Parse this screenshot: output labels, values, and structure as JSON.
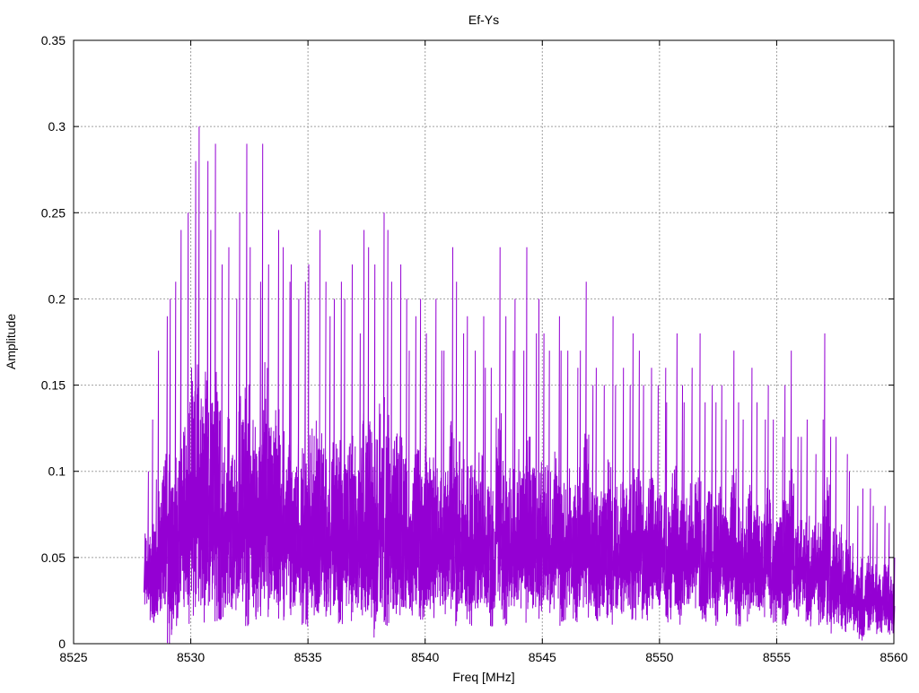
{
  "chart_data": {
    "type": "line",
    "title": "Ef-Ys",
    "xlabel": "Freq [MHz]",
    "ylabel": "Amplitude",
    "xlim": [
      8525,
      8560
    ],
    "ylim": [
      0,
      0.35
    ],
    "xticks": [
      8525,
      8530,
      8535,
      8540,
      8545,
      8550,
      8555,
      8560
    ],
    "yticks": [
      0,
      0.05,
      0.1,
      0.15,
      0.2,
      0.25,
      0.3,
      0.35
    ],
    "ytick_labels": [
      "0",
      "0.05",
      "0.1",
      "0.15",
      "0.2",
      "0.25",
      "0.3",
      "0.35"
    ],
    "grid": true,
    "legend": "none",
    "series": [
      {
        "name": "Ef-Ys",
        "color": "#9400d3",
        "x_start": 8528,
        "x_step": 0.25,
        "bin_max": [
          0.1,
          0.13,
          0.17,
          0.19,
          0.2,
          0.21,
          0.24,
          0.25,
          0.28,
          0.3,
          0.28,
          0.24,
          0.29,
          0.22,
          0.23,
          0.2,
          0.25,
          0.29,
          0.23,
          0.21,
          0.29,
          0.22,
          0.24,
          0.23,
          0.21,
          0.22,
          0.2,
          0.21,
          0.22,
          0.24,
          0.21,
          0.19,
          0.2,
          0.21,
          0.2,
          0.22,
          0.18,
          0.24,
          0.23,
          0.22,
          0.25,
          0.24,
          0.21,
          0.22,
          0.2,
          0.17,
          0.19,
          0.2,
          0.18,
          0.2,
          0.17,
          0.17,
          0.23,
          0.21,
          0.18,
          0.19,
          0.17,
          0.19,
          0.16,
          0.16,
          0.23,
          0.19,
          0.17,
          0.2,
          0.17,
          0.23,
          0.18,
          0.2,
          0.18,
          0.17,
          0.19,
          0.17,
          0.17,
          0.16,
          0.17,
          0.21,
          0.15,
          0.16,
          0.15,
          0.19,
          0.15,
          0.16,
          0.15,
          0.18,
          0.17,
          0.15,
          0.16,
          0.15,
          0.16,
          0.14,
          0.18,
          0.15,
          0.14,
          0.16,
          0.18,
          0.14,
          0.15,
          0.14,
          0.15,
          0.13,
          0.17,
          0.14,
          0.13,
          0.16,
          0.14,
          0.13,
          0.15,
          0.13,
          0.12,
          0.15,
          0.17,
          0.12,
          0.12,
          0.13,
          0.11,
          0.13,
          0.18,
          0.12,
          0.12,
          0.11,
          0.1,
          0.08,
          0.09,
          0.09,
          0.08,
          0.07,
          0.08,
          0.07,
          0.05
        ],
        "bin_min": [
          0.02,
          0.01,
          0.01,
          0.02,
          0.0,
          0.01,
          0.02,
          0.01,
          0.015,
          0.02,
          0.01,
          0.02,
          0.01,
          0.01,
          0.02,
          0.015,
          0.02,
          0.01,
          0.02,
          0.01,
          0.02,
          0.015,
          0.02,
          0.01,
          0.02,
          0.015,
          0.02,
          0.01,
          0.02,
          0.01,
          0.02,
          0.015,
          0.02,
          0.01,
          0.02,
          0.01,
          0.02,
          0.015,
          0.01,
          0.0,
          0.02,
          0.01,
          0.02,
          0.01,
          0.02,
          0.015,
          0.02,
          0.01,
          0.02,
          0.01,
          0.02,
          0.015,
          0.02,
          0.01,
          0.02,
          0.01,
          0.02,
          0.015,
          0.02,
          0.01,
          0.02,
          0.01,
          0.02,
          0.015,
          0.02,
          0.01,
          0.02,
          0.01,
          0.02,
          0.015,
          0.02,
          0.01,
          0.02,
          0.01,
          0.02,
          0.015,
          0.02,
          0.01,
          0.02,
          0.01,
          0.02,
          0.015,
          0.02,
          0.01,
          0.02,
          0.01,
          0.02,
          0.015,
          0.02,
          0.01,
          0.02,
          0.01,
          0.02,
          0.015,
          0.02,
          0.01,
          0.02,
          0.01,
          0.02,
          0.015,
          0.02,
          0.01,
          0.02,
          0.01,
          0.02,
          0.015,
          0.02,
          0.01,
          0.02,
          0.01,
          0.02,
          0.015,
          0.02,
          0.01,
          0.02,
          0.01,
          0.01,
          0.005,
          0.01,
          0.005,
          0.01,
          0.005,
          0.0,
          0.005,
          0.01,
          0.005,
          0.01,
          0.005,
          0.0
        ]
      }
    ]
  }
}
